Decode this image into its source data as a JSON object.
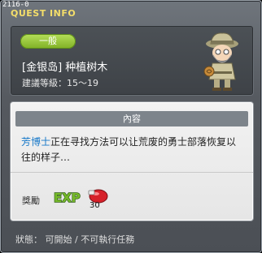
{
  "window": {
    "quest_id": "2116-0",
    "title": "QUEST INFO"
  },
  "quest": {
    "category": "一般",
    "name": "[金银岛] 种植树木",
    "level": "建議等級：15～19"
  },
  "content": {
    "header": "內容",
    "npc_name": "芳博士",
    "description": "正在寻找方法可以让荒废的勇士部落恢复以往的样子…"
  },
  "reward": {
    "label": "獎勵",
    "exp_text": "EXP",
    "item_count": "30"
  },
  "status": "狀態： 可開始 / 不可執行任務"
}
